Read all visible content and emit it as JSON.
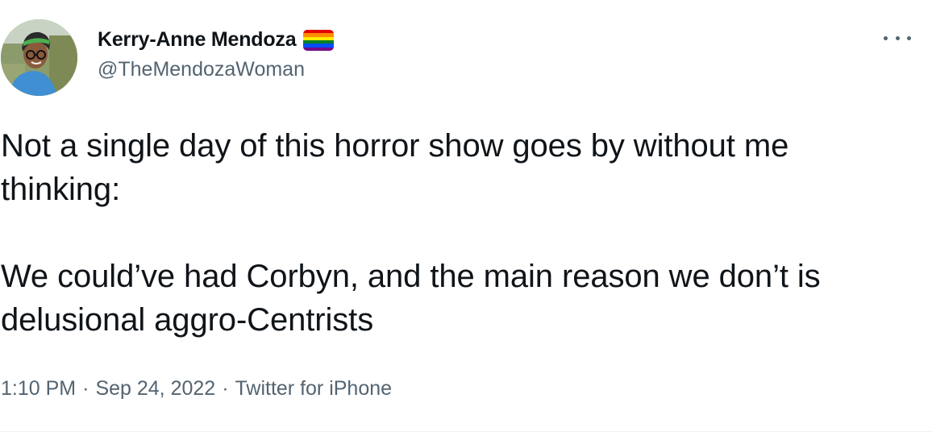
{
  "author": {
    "display_name": "Kerry-Anne Mendoza",
    "handle": "@TheMendozaWoman",
    "badge": "rainbow-flag-icon",
    "flag_colors": [
      "#e40303",
      "#ff8c00",
      "#ffed00",
      "#008026",
      "#004dff",
      "#750787"
    ]
  },
  "tweet": {
    "text": "Not a single day of this horror show goes by without me thinking:\n\nWe could’ve had Corbyn, and the main reason we don’t is delusional aggro-Centrists",
    "time": "1:10 PM",
    "separator": "·",
    "date": "Sep 24, 2022",
    "source": "Twitter for iPhone"
  },
  "menu": {
    "icon": "more-options-icon"
  }
}
